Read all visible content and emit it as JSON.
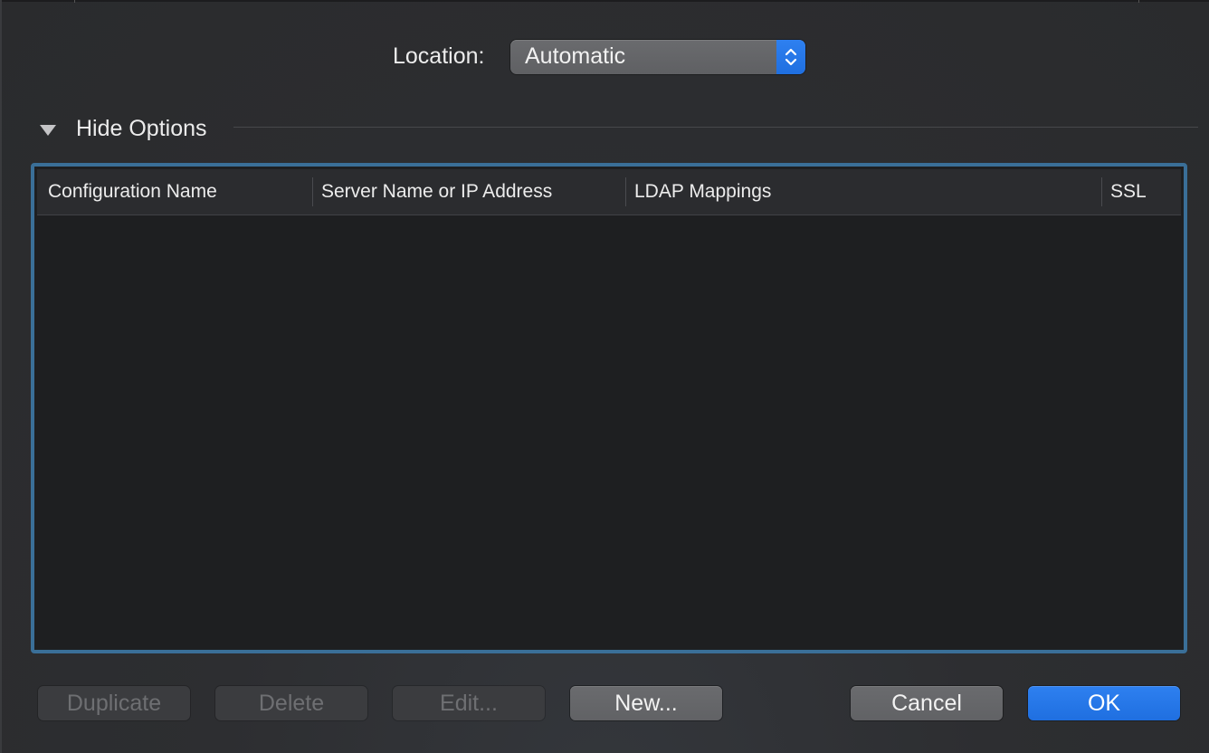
{
  "location": {
    "label": "Location:",
    "selected": "Automatic"
  },
  "options": {
    "toggle_label": "Hide Options",
    "expanded": true
  },
  "table": {
    "columns": [
      "Configuration Name",
      "Server Name or IP Address",
      "LDAP Mappings",
      "SSL"
    ],
    "rows": []
  },
  "buttons": {
    "duplicate": "Duplicate",
    "delete": "Delete",
    "edit": "Edit...",
    "new": "New...",
    "cancel": "Cancel",
    "ok": "OK"
  },
  "colors": {
    "accent": "#1f6fe0",
    "focus_ring": "#3a6f98",
    "sheet_background": "#2d2e31",
    "table_background": "#1e1f21"
  }
}
